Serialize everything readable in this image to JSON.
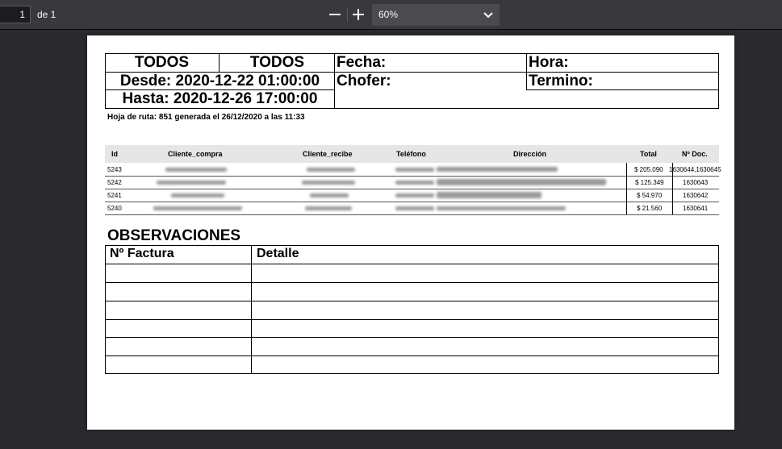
{
  "toolbar": {
    "page_number": "1",
    "page_of": "de 1",
    "zoom_value": "60%"
  },
  "report": {
    "todos_left": "TODOS",
    "todos_right": "TODOS",
    "desde": "Desde: 2020-12-22 01:00:00",
    "hasta": "Hasta: 2020-12-26 17:00:00",
    "fecha_label": "Fecha:",
    "chofer_label": "Chofer:",
    "hora_label": "Hora:",
    "termino_label": "Termino:",
    "route_info": "Hoja de ruta: 851  generada el 26/12/2020 a las 11:33"
  },
  "table": {
    "headers": {
      "id": "Id",
      "cliente_compra": "Cliente_compra",
      "cliente_recibe": "Cliente_recibe",
      "telefono": "Teléfono",
      "direccion": "Dirección",
      "total": "Total",
      "ndoc": "Nº Doc."
    },
    "rows": [
      {
        "id": "5243",
        "total": "$ 205.090",
        "ndoc": "1630644,1630645"
      },
      {
        "id": "5242",
        "total": "$ 125.349",
        "ndoc": "1630643"
      },
      {
        "id": "5241",
        "total": "$ 54.970",
        "ndoc": "1630642"
      },
      {
        "id": "5240",
        "total": "$ 21.560",
        "ndoc": "1630641"
      }
    ]
  },
  "observaciones": {
    "title": "OBSERVACIONES",
    "col_factura": "Nº Factura",
    "col_detalle": "Detalle"
  }
}
